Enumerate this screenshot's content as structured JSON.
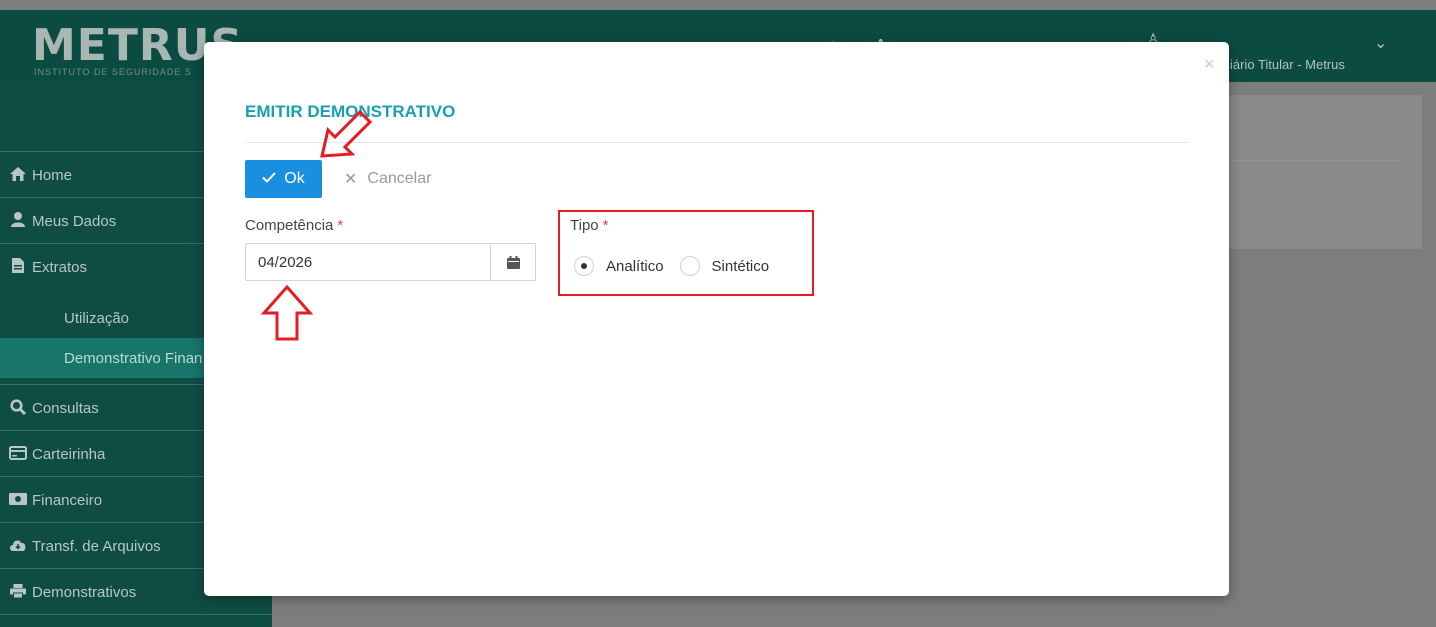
{
  "header": {
    "logo": "METRUS",
    "logo_subtitle": "INSTITUTO DE SEGURIDADE S",
    "user_name": "iário Titular - Metrus"
  },
  "sidebar": {
    "items": [
      {
        "label": "Home",
        "icon": "home-icon"
      },
      {
        "label": "Meus Dados",
        "icon": "user-icon"
      },
      {
        "label": "Extratos",
        "icon": "document-icon"
      },
      {
        "label": "Utilização",
        "icon": ""
      },
      {
        "label": "Demonstrativo Finan",
        "icon": ""
      },
      {
        "label": "Consultas",
        "icon": "search-icon"
      },
      {
        "label": "Carteirinha",
        "icon": "card-icon"
      },
      {
        "label": "Financeiro",
        "icon": "money-icon"
      },
      {
        "label": "Transf. de Arquivos",
        "icon": "cloud-download-icon"
      },
      {
        "label": "Demonstrativos",
        "icon": "printer-icon"
      }
    ]
  },
  "modal": {
    "title": "EMITIR DEMONSTRATIVO",
    "ok_label": "Ok",
    "cancel_label": "Cancelar",
    "competencia_label": "Competência",
    "competencia_value": "04/2026",
    "required_mark": "*",
    "tipo_label": "Tipo",
    "tipo_options": [
      {
        "label": "Analítico",
        "selected": true
      },
      {
        "label": "Sintético",
        "selected": false
      }
    ]
  },
  "colors": {
    "brand_dark": "#0c4b41",
    "accent_title": "#1aa0ae",
    "primary_button": "#1a8fe0",
    "annotation_red": "#e51c23"
  }
}
